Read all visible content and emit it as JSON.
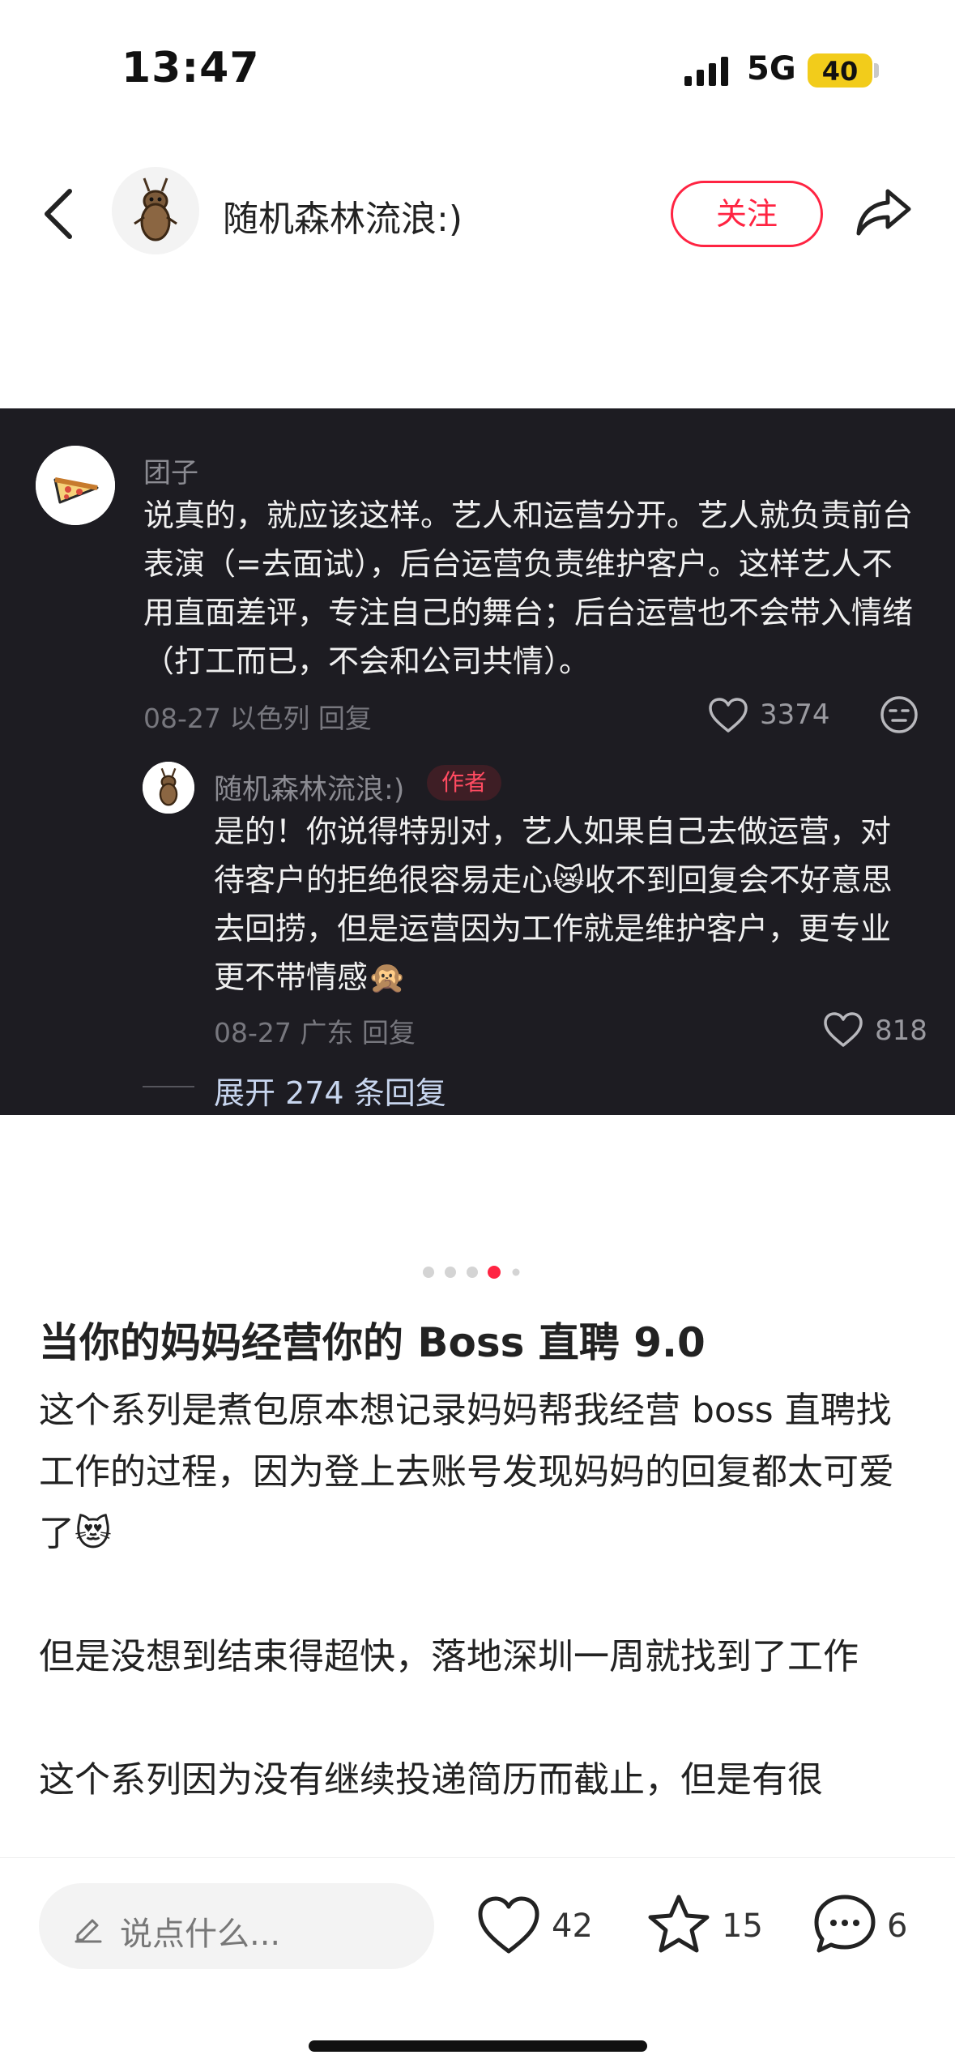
{
  "status_bar": {
    "time": "13:47",
    "network": "5G",
    "battery": "40"
  },
  "header": {
    "username": "随机森林流浪:)",
    "follow_label": "关注"
  },
  "comment": {
    "author": "团子",
    "text": "说真的，就应该这样。艺人和运营分开。艺人就负责前台表演（=去面试），后台运营负责维护客户。这样艺人不用直面差评，专注自己的舞台；后台运营也不会带入情绪（打工而已，不会和公司共情）。",
    "meta": "08-27 以色列 回复",
    "likes": "3374"
  },
  "reply": {
    "author": "随机森林流浪:)",
    "badge": "作者",
    "text": "是的！你说得特别对，艺人如果自己去做运营，对待客户的拒绝很容易走心😿收不到回复会不好意思去回捞，但是运营因为工作就是维护客户，更专业更不带情感🙊",
    "meta": "08-27 广东 回复",
    "likes": "818"
  },
  "expand_label": "展开 274 条回复",
  "carousel": {
    "total": 5,
    "active": 4
  },
  "post": {
    "title": "当你的妈妈经营你的 Boss 直聘 9.0",
    "paragraphs": [
      "这个系列是煮包原本想记录妈妈帮我经营 boss 直聘找工作的过程，因为登上去账号发现妈妈的回复都太可爱了😻",
      "但是没想到结束得超快，落地深圳一周就找到了工作",
      "这个系列因为没有继续投递简历而截止，但是有很"
    ]
  },
  "bottom_bar": {
    "input_placeholder": "说点什么...",
    "likes": "42",
    "collects": "15",
    "comments": "6"
  },
  "colors": {
    "accent": "#ff2442",
    "panel_bg": "#1d1c22"
  }
}
